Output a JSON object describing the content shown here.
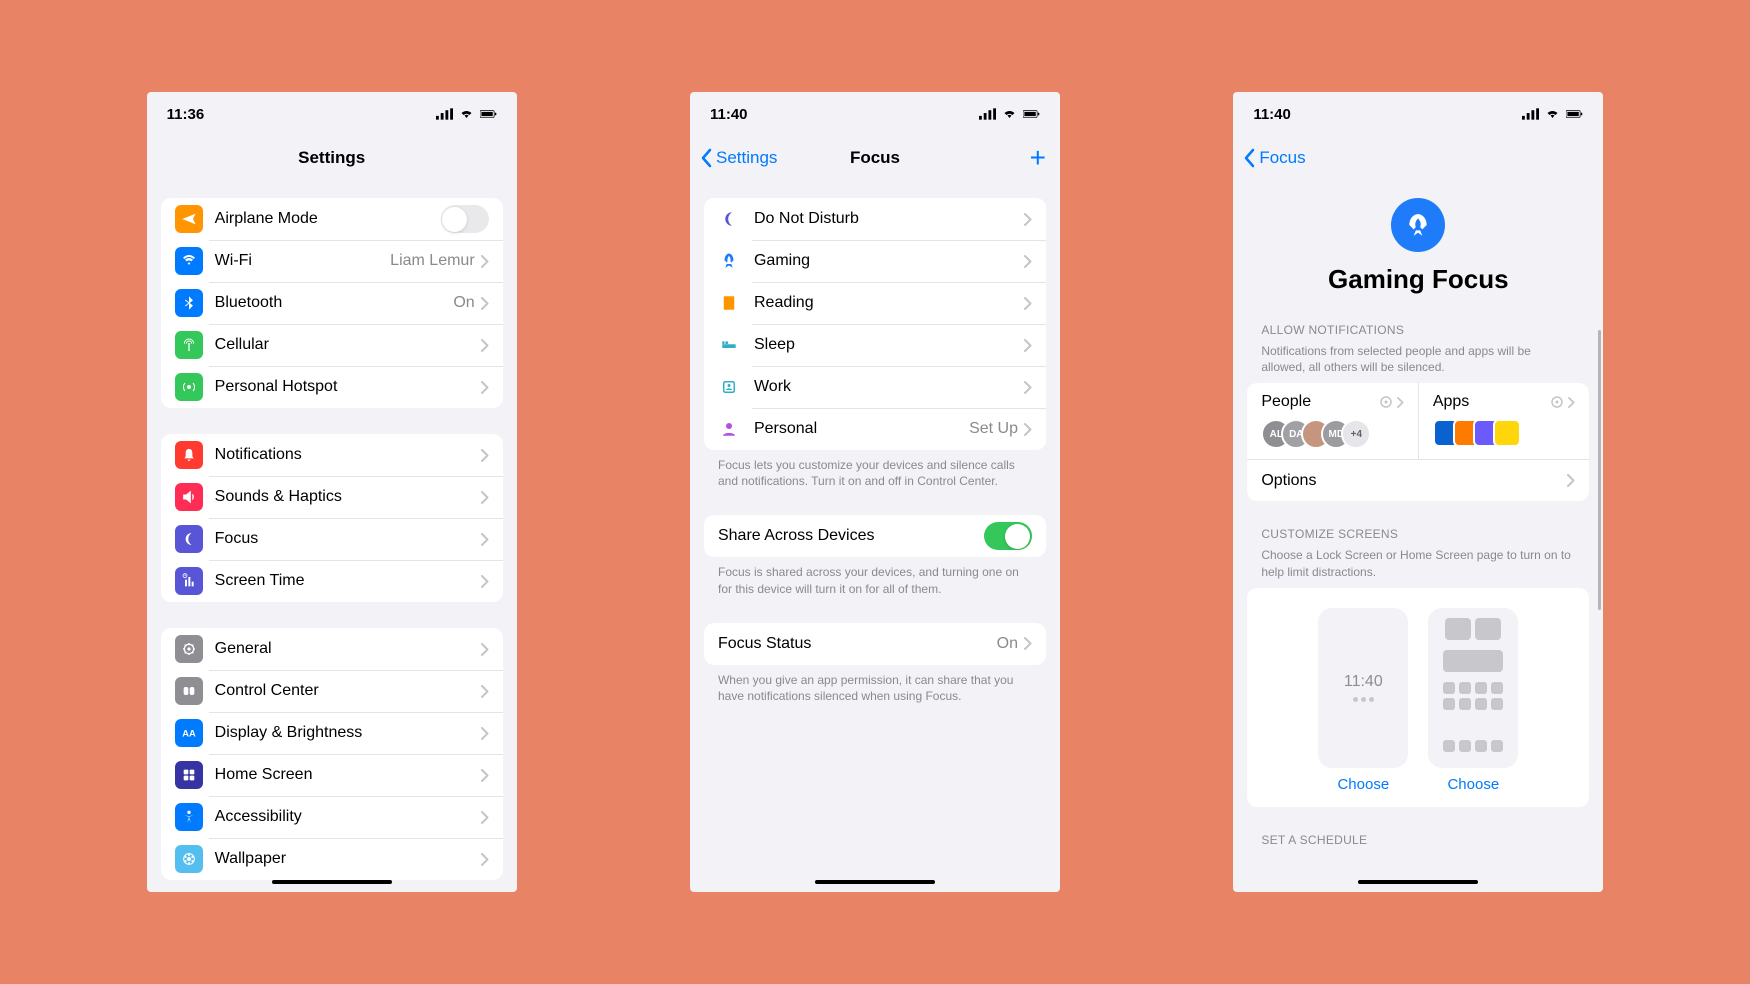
{
  "background_color": "#e88366",
  "screen1": {
    "status_time": "11:36",
    "title": "Settings",
    "groups": [
      {
        "rows": [
          {
            "icon": "airplane",
            "icon_bg": "#ff9500",
            "label": "Airplane Mode",
            "trailing": "toggle-off"
          },
          {
            "icon": "wifi",
            "icon_bg": "#007aff",
            "label": "Wi-Fi",
            "detail": "Liam Lemur",
            "trailing": "chevron"
          },
          {
            "icon": "bluetooth",
            "icon_bg": "#007aff",
            "label": "Bluetooth",
            "detail": "On",
            "trailing": "chevron"
          },
          {
            "icon": "cellular",
            "icon_bg": "#34c759",
            "label": "Cellular",
            "trailing": "chevron"
          },
          {
            "icon": "hotspot",
            "icon_bg": "#34c759",
            "label": "Personal Hotspot",
            "trailing": "chevron"
          }
        ]
      },
      {
        "rows": [
          {
            "icon": "notifications",
            "icon_bg": "#ff3b30",
            "label": "Notifications",
            "trailing": "chevron"
          },
          {
            "icon": "sounds",
            "icon_bg": "#ff2d55",
            "label": "Sounds & Haptics",
            "trailing": "chevron"
          },
          {
            "icon": "focus",
            "icon_bg": "#5856d6",
            "label": "Focus",
            "trailing": "chevron"
          },
          {
            "icon": "screentime",
            "icon_bg": "#5856d6",
            "label": "Screen Time",
            "trailing": "chevron"
          }
        ]
      },
      {
        "rows": [
          {
            "icon": "general",
            "icon_bg": "#8e8e93",
            "label": "General",
            "trailing": "chevron"
          },
          {
            "icon": "control",
            "icon_bg": "#8e8e93",
            "label": "Control Center",
            "trailing": "chevron"
          },
          {
            "icon": "display",
            "icon_bg": "#007aff",
            "label": "Display & Brightness",
            "trailing": "chevron"
          },
          {
            "icon": "home",
            "icon_bg": "#3634a3",
            "label": "Home Screen",
            "trailing": "chevron"
          },
          {
            "icon": "accessibility",
            "icon_bg": "#007aff",
            "label": "Accessibility",
            "trailing": "chevron"
          },
          {
            "icon": "wallpaper",
            "icon_bg": "#55bef0",
            "label": "Wallpaper",
            "trailing": "chevron"
          }
        ]
      }
    ]
  },
  "screen2": {
    "status_time": "11:40",
    "back_label": "Settings",
    "title": "Focus",
    "focus_rows": [
      {
        "icon": "moon",
        "color": "#5856d6",
        "label": "Do Not Disturb"
      },
      {
        "icon": "rocket",
        "color": "#1e7cfa",
        "label": "Gaming"
      },
      {
        "icon": "book",
        "color": "#ff9500",
        "label": "Reading"
      },
      {
        "icon": "bed",
        "color": "#30b0c7",
        "label": "Sleep"
      },
      {
        "icon": "badge",
        "color": "#30b0c7",
        "label": "Work"
      },
      {
        "icon": "person",
        "color": "#af52de",
        "label": "Personal",
        "detail": "Set Up"
      }
    ],
    "focus_footer": "Focus lets you customize your devices and silence calls and notifications. Turn it on and off in Control Center.",
    "share_label": "Share Across Devices",
    "share_footer": "Focus is shared across your devices, and turning one on for this device will turn it on for all of them.",
    "status_label": "Focus Status",
    "status_detail": "On",
    "status_footer": "When you give an app permission, it can share that you have notifications silenced when using Focus."
  },
  "screen3": {
    "status_time": "11:40",
    "back_label": "Focus",
    "hero_title": "Gaming Focus",
    "allow_header": "ALLOW NOTIFICATIONS",
    "allow_desc": "Notifications from selected people and apps will be allowed, all others will be silenced.",
    "people_label": "People",
    "apps_label": "Apps",
    "people_avatars": [
      "AL",
      "DA",
      "",
      "MD"
    ],
    "people_more": "+4",
    "app_colors": [
      "#0a62d0",
      "#ff7a00",
      "#6b5bff",
      "#ffd60a"
    ],
    "options_label": "Options",
    "customize_header": "CUSTOMIZE SCREENS",
    "customize_desc": "Choose a Lock Screen or Home Screen page to turn on to help limit distractions.",
    "lock_time": "11:40",
    "choose_label": "Choose",
    "schedule_header": "SET A SCHEDULE"
  }
}
